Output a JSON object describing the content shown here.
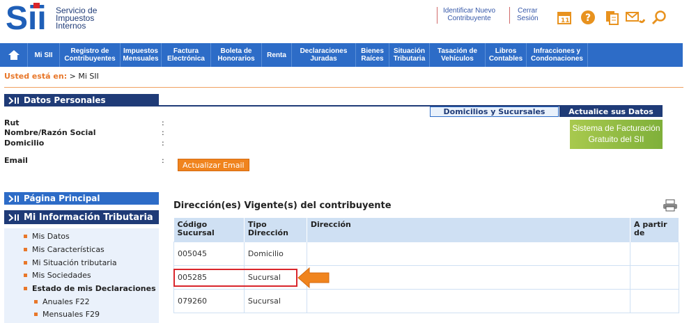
{
  "header": {
    "logo_lines": [
      "Servicio de",
      "Impuestos",
      "Internos"
    ],
    "identificar": [
      "Identificar Nuevo",
      "Contribuyente"
    ],
    "cerrar": [
      "Cerrar",
      "Sesión"
    ]
  },
  "nav": [
    {
      "lines": [
        "Mi SII"
      ],
      "w": 46
    },
    {
      "lines": [
        "Registro de",
        "Contribuyentes"
      ],
      "w": 87
    },
    {
      "lines": [
        "Impuestos",
        "Mensuales"
      ],
      "w": 59
    },
    {
      "lines": [
        "Factura",
        "Electrónica"
      ],
      "w": 71
    },
    {
      "lines": [
        "Boleta de",
        "Honorarios"
      ],
      "w": 73
    },
    {
      "lines": [
        "Renta"
      ],
      "w": 43
    },
    {
      "lines": [
        "Declaraciones",
        "Juradas"
      ],
      "w": 92
    },
    {
      "lines": [
        "Bienes",
        "Raíces"
      ],
      "w": 48
    },
    {
      "lines": [
        "Situación",
        "Tributaria"
      ],
      "w": 58
    },
    {
      "lines": [
        "Tasación de",
        "Vehículos"
      ],
      "w": 80
    },
    {
      "lines": [
        "Libros",
        "Contables"
      ],
      "w": 59
    },
    {
      "lines": [
        "Infracciones y",
        "Condonaciones"
      ],
      "w": 88
    }
  ],
  "breadcrumb": {
    "label": "Usted está en:",
    "value": "> Mi SII"
  },
  "datos": {
    "title": "Datos Personales",
    "tab_domicilios": "Domicilios y Sucursales",
    "tab_actualice": "Actualice sus Datos",
    "sistema": [
      "Sistema de Facturación",
      "Gratuito del SII"
    ],
    "fields": [
      "Rut",
      "Nombre/Razón Social",
      "Domicilio",
      "Email"
    ],
    "btn_email": "Actualizar Email"
  },
  "left": {
    "pagina": "Página Principal",
    "mi_info": "Mi Información Tributaria",
    "items": [
      "Mis Datos",
      "Mis Características",
      "Mi Situación tributaria",
      "Mis Sociedades",
      "Estado de mis Declaraciones",
      "Anuales F22",
      "Mensuales F29"
    ]
  },
  "table": {
    "title": "Dirección(es) Vigente(s) del contribuyente",
    "headers": [
      [
        "Código",
        "Sucursal"
      ],
      [
        "Tipo",
        "Dirección"
      ],
      [
        "Dirección"
      ],
      [
        "A partir",
        "de"
      ]
    ],
    "rows": [
      [
        "005045",
        "Domicilio",
        "",
        ""
      ],
      [
        "005285",
        "Sucursal",
        "",
        ""
      ],
      [
        "079260",
        "Sucursal",
        "",
        ""
      ]
    ]
  },
  "colors": {
    "nav_blue": "#2d6cc7",
    "dark_blue": "#1f3b77",
    "accent_orange": "#f0841e",
    "highlight_red": "#d9262c"
  }
}
